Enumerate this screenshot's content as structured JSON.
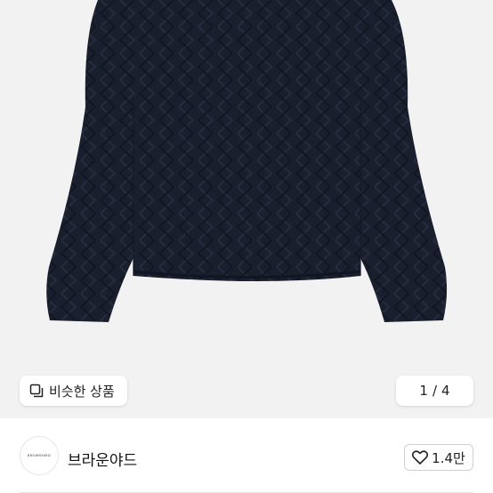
{
  "product": {
    "similar_label": "비슷한 상품",
    "pager": {
      "current": "1",
      "separator": "/",
      "total": "4"
    }
  },
  "seller": {
    "name": "브라운야드",
    "avatar_logo_text": "BROWNYARD",
    "likes": "1.4만"
  },
  "icons": {
    "similar": "similar-products-icon",
    "like": "heart-outline-icon"
  },
  "colors": {
    "photo_background": "#f2f2f2",
    "garment": "#1a1f2e",
    "text": "#222222"
  }
}
